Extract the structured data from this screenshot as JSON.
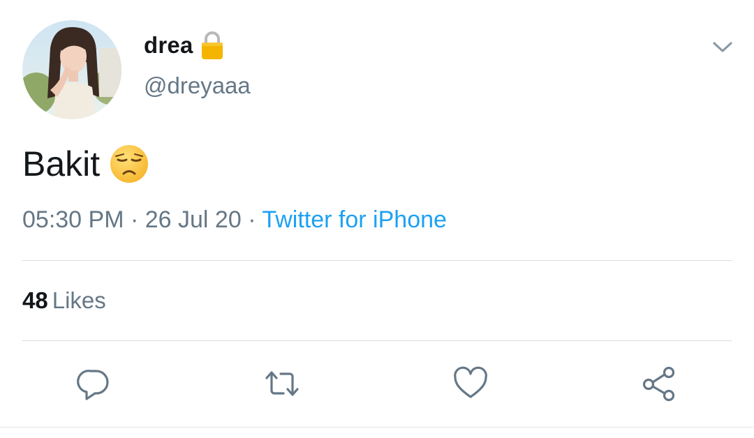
{
  "user": {
    "display_name": "drea",
    "handle": "@dreyaaa",
    "protected_icon": "lock-icon",
    "avatar_icon": "profile-photo"
  },
  "tweet": {
    "text": "Bakit",
    "emoji": "disappointed-face-emoji"
  },
  "meta": {
    "time": "05:30 PM",
    "sep1": " · ",
    "date": "26 Jul 20",
    "sep2": " · ",
    "source": "Twitter for iPhone"
  },
  "stats": {
    "likes_count": "48",
    "likes_label": "Likes"
  },
  "actions": [
    "reply-icon",
    "retweet-icon",
    "like-icon",
    "share-icon"
  ],
  "colors": {
    "text": "#14171a",
    "secondary": "#657786",
    "link": "#1da1f2",
    "divider": "#d6dce0"
  }
}
